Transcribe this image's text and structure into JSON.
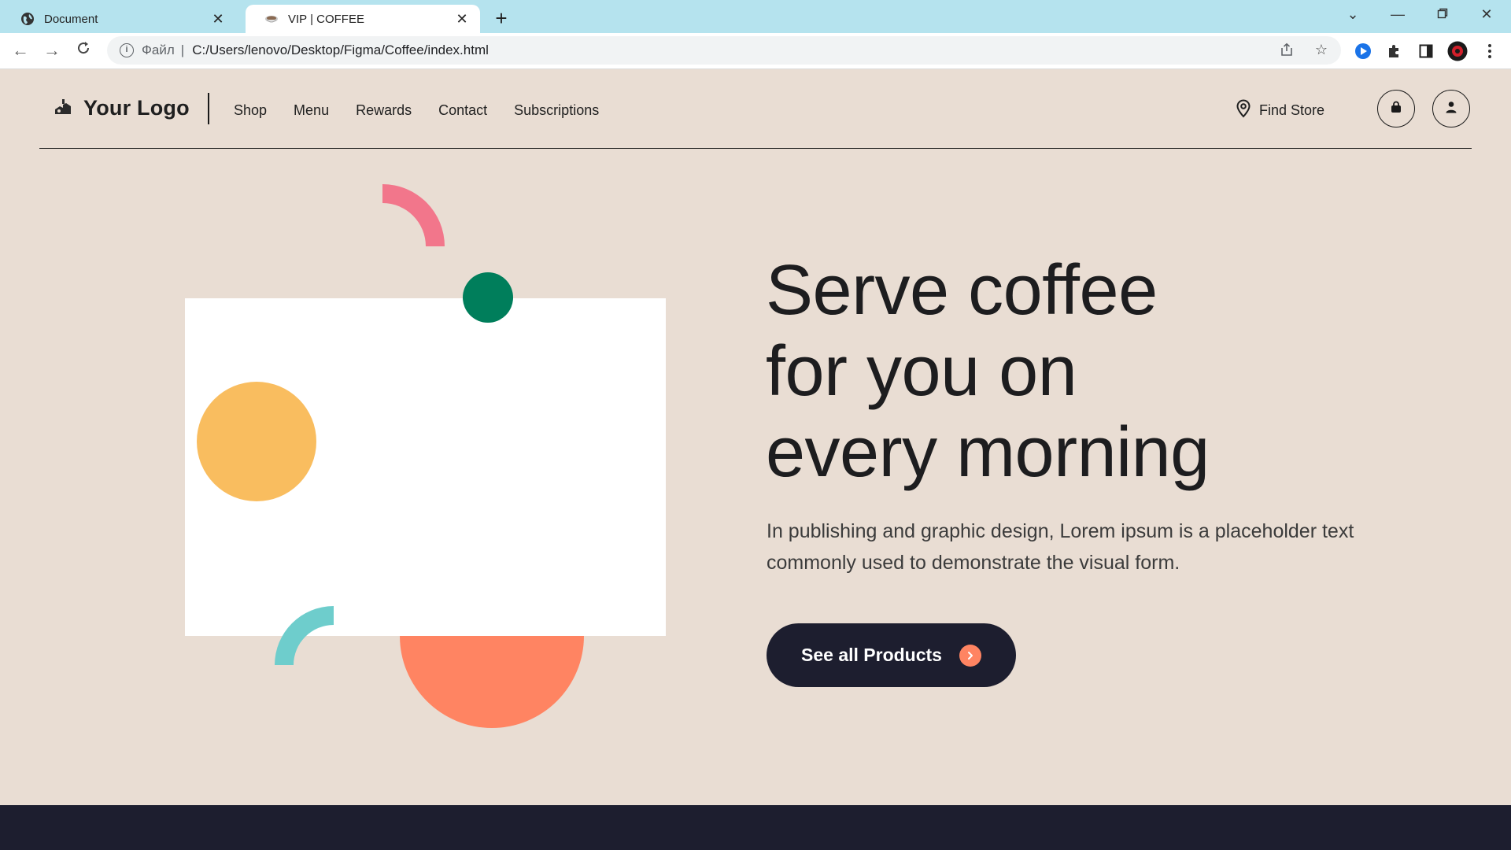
{
  "browser": {
    "tabs": [
      {
        "title": "Document",
        "icon": "globe-icon",
        "active": false
      },
      {
        "title": "VIP | COFFEE",
        "icon": "coffee-cup-icon",
        "active": true
      }
    ],
    "address": {
      "scheme_label": "Файл",
      "url": "C:/Users/lenovo/Desktop/Figma/Coffee/index.html"
    }
  },
  "site": {
    "logo_text": "Your Logo",
    "nav": [
      "Shop",
      "Menu",
      "Rewards",
      "Contact",
      "Subscriptions"
    ],
    "find_store": "Find Store",
    "headline": [
      "Serve coffee",
      "for you on",
      "every morning"
    ],
    "subtext": "In publishing and graphic design, Lorem ipsum is a placeholder text commonly used to demonstrate the visual form.",
    "cta_label": "See all Products"
  },
  "colors": {
    "page_bg": "#e9ddd3",
    "dark": "#1d1e2f",
    "pink_arc": "#f2768b",
    "green_dot": "#007e5b",
    "yellow_circle": "#f9bd5f",
    "orange_circle": "#ff8462",
    "teal_arc": "#6ecdcc"
  }
}
